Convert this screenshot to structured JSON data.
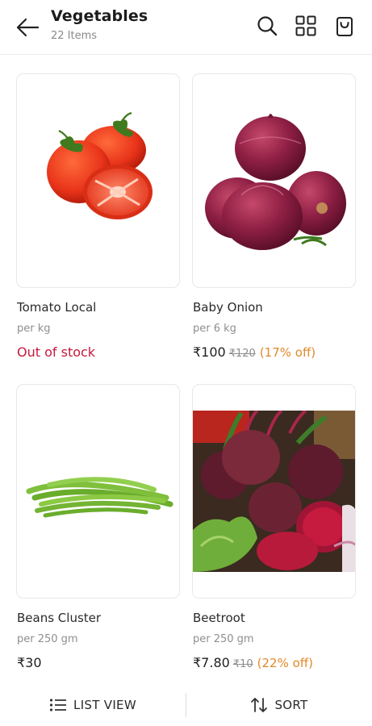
{
  "header": {
    "title": "Vegetables",
    "subtitle": "22 Items",
    "icons": [
      "back-arrow-icon",
      "search-icon",
      "grid-view-icon",
      "cart-icon"
    ]
  },
  "products": [
    {
      "name": "Tomato Local",
      "unit": "per kg",
      "status": "Out of stock"
    },
    {
      "name": "Baby Onion",
      "unit": "per 6 kg",
      "price": "₹100",
      "mrp": "₹120",
      "discount": "(17% off)"
    },
    {
      "name": "Beans Cluster",
      "unit": "per 250 gm",
      "price": "₹30"
    },
    {
      "name": "Beetroot",
      "unit": "per 250 gm",
      "price": "₹7.80",
      "mrp": "₹10",
      "discount": "(22% off)"
    }
  ],
  "bottom_bar": {
    "list_view_label": "LIST VIEW",
    "sort_label": "SORT"
  },
  "colors": {
    "out_of_stock": "#c8173b",
    "discount": "#e08a2b",
    "muted_text": "#8e8e8e"
  }
}
